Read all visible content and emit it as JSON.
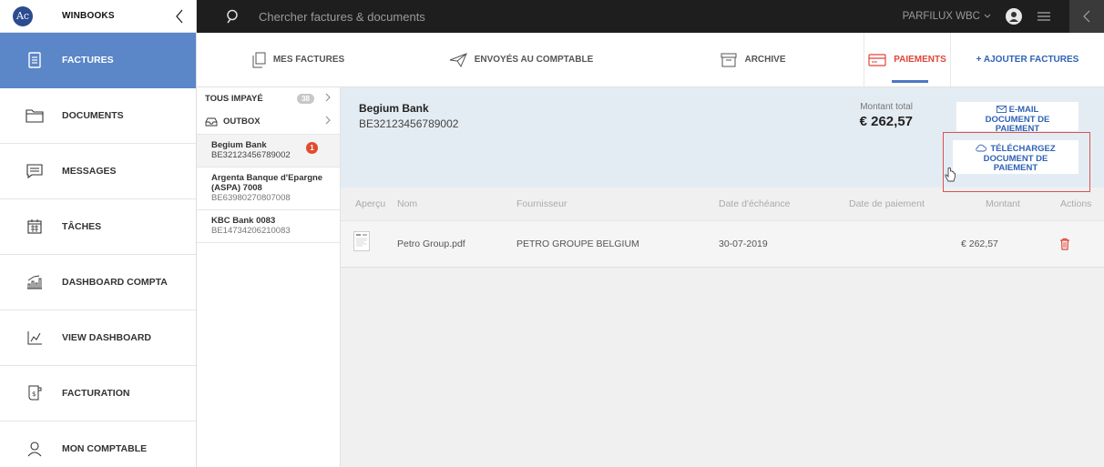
{
  "app": {
    "logo_text": "Ac",
    "brand": "WINBOOKS"
  },
  "sidebar": {
    "items": [
      {
        "label": "FACTURES",
        "icon": "invoice-icon"
      },
      {
        "label": "DOCUMENTS",
        "icon": "folder-icon"
      },
      {
        "label": "MESSAGES",
        "icon": "message-icon"
      },
      {
        "label": "TÂCHES",
        "icon": "calendar-icon"
      },
      {
        "label": "DASHBOARD COMPTA",
        "icon": "bar-chart-icon"
      },
      {
        "label": "VIEW DASHBOARD",
        "icon": "line-chart-icon"
      },
      {
        "label": "FACTURATION",
        "icon": "billing-icon"
      },
      {
        "label": "MON COMPTABLE",
        "icon": "user-icon"
      }
    ]
  },
  "topbar": {
    "search_placeholder": "Chercher factures & documents",
    "company": "PARFILUX WBC"
  },
  "tabs": {
    "mes_factures": "MES FACTURES",
    "envoyes": "ENVOYÉS AU COMPTABLE",
    "archive": "ARCHIVE",
    "paiements": "PAIEMENTS",
    "ajouter": "+ AJOUTER FACTURES"
  },
  "accounts": {
    "all_label": "TOUS IMPAYÉ",
    "all_count": "38",
    "outbox_label": "OUTBOX",
    "banks": [
      {
        "name": "Begium Bank",
        "iban": "BE32123456789002",
        "badge": "1"
      },
      {
        "name": "Argenta Banque d'Epargne (ASPA) 7008",
        "iban": "BE63980270807008"
      },
      {
        "name": "KBC Bank 0083",
        "iban": "BE14734206210083"
      }
    ]
  },
  "detail": {
    "bank": "Begium Bank",
    "iban": "BE32123456789002",
    "total_label": "Montant total",
    "total": "€ 262,57",
    "email_line1": "E-MAIL",
    "email_line2": "DOCUMENT DE",
    "email_line3": "PAIEMENT",
    "download_line1": "TÉLÉCHARGEZ",
    "download_line2": "DOCUMENT DE",
    "download_line3": "PAIEMENT"
  },
  "table": {
    "headers": {
      "apercu": "Aperçu",
      "nom": "Nom",
      "fournisseur": "Fournisseur",
      "echeance": "Date d'échéance",
      "paiement": "Date de paiement",
      "montant": "Montant",
      "actions": "Actions"
    },
    "rows": [
      {
        "nom": "Petro Group.pdf",
        "fournisseur": "PETRO GROUPE BELGIUM",
        "echeance": "30-07-2019",
        "paiement": "",
        "montant": "€ 262,57"
      }
    ]
  },
  "colors": {
    "sidebar_active": "#5b86c8",
    "topbar": "#1e1e1e",
    "accent_blue": "#2f62b5",
    "accent_red": "#e0453a",
    "header_panel": "#e4ecf3"
  }
}
